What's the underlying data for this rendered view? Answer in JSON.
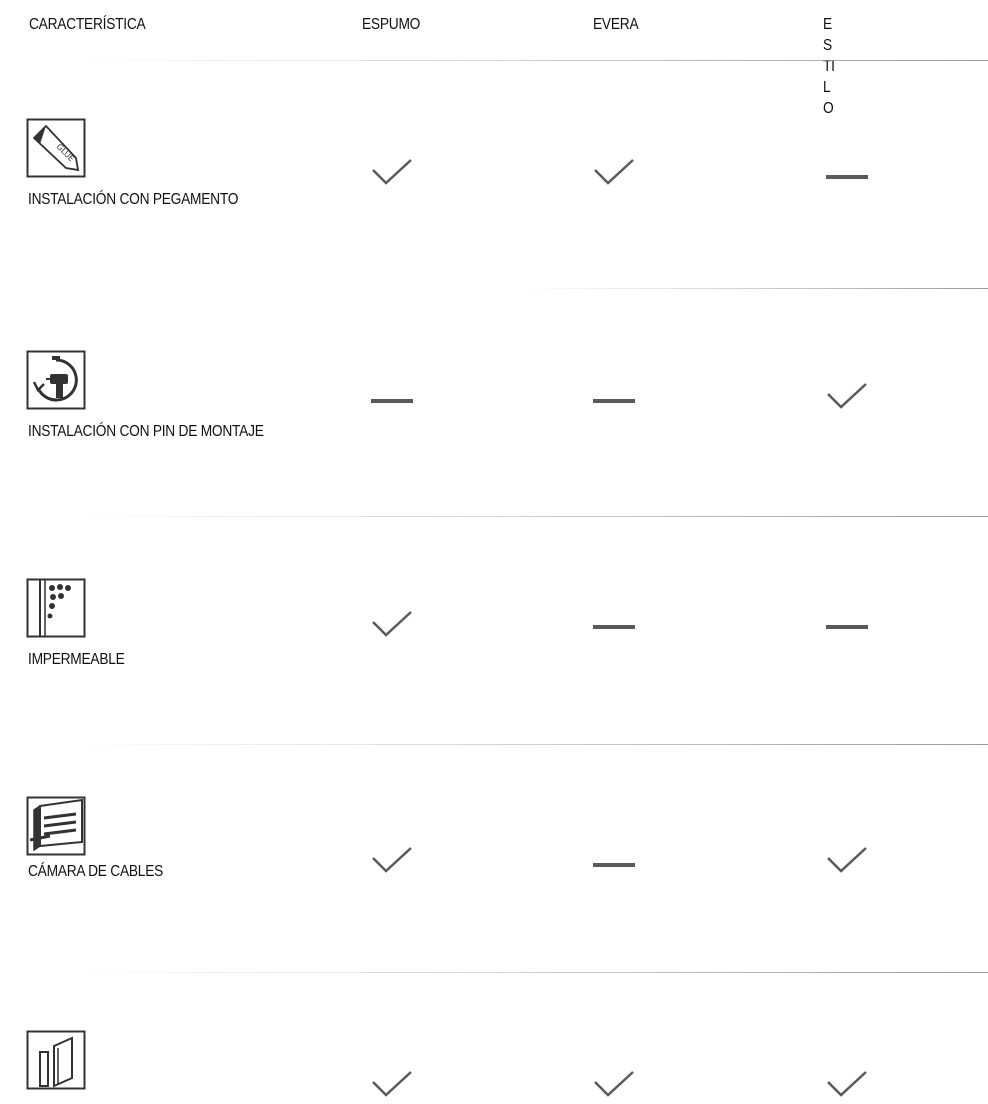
{
  "header": {
    "feature": "CARACTERÍSTICA",
    "columns": [
      "ESPUMO",
      "EVERA",
      "ESTIL O"
    ]
  },
  "rows": [
    {
      "label": "INSTALACIÓN CON PEGAMENTO",
      "icon": "glue-bottle-icon",
      "values": [
        "check",
        "check",
        "dash"
      ]
    },
    {
      "label": "INSTALACIÓN CON PIN DE MONTAJE",
      "icon": "drill-clock-icon",
      "values": [
        "dash",
        "dash",
        "check"
      ]
    },
    {
      "label": "IMPERMEABLE",
      "icon": "water-drops-wall-icon",
      "values": [
        "check",
        "dash",
        "dash"
      ]
    },
    {
      "label": "CÁMARA DE CABLES",
      "icon": "cable-channel-icon",
      "values": [
        "check",
        "dash",
        "check"
      ]
    },
    {
      "label": "",
      "icon": "profile-corner-icon",
      "values": [
        "check",
        "check",
        "check"
      ]
    }
  ],
  "icons": {
    "check": "check-icon",
    "dash": "dash-icon"
  },
  "colors": {
    "mark": "#5a5a5a",
    "rule": "#9a9a9a",
    "text": "#111111"
  }
}
